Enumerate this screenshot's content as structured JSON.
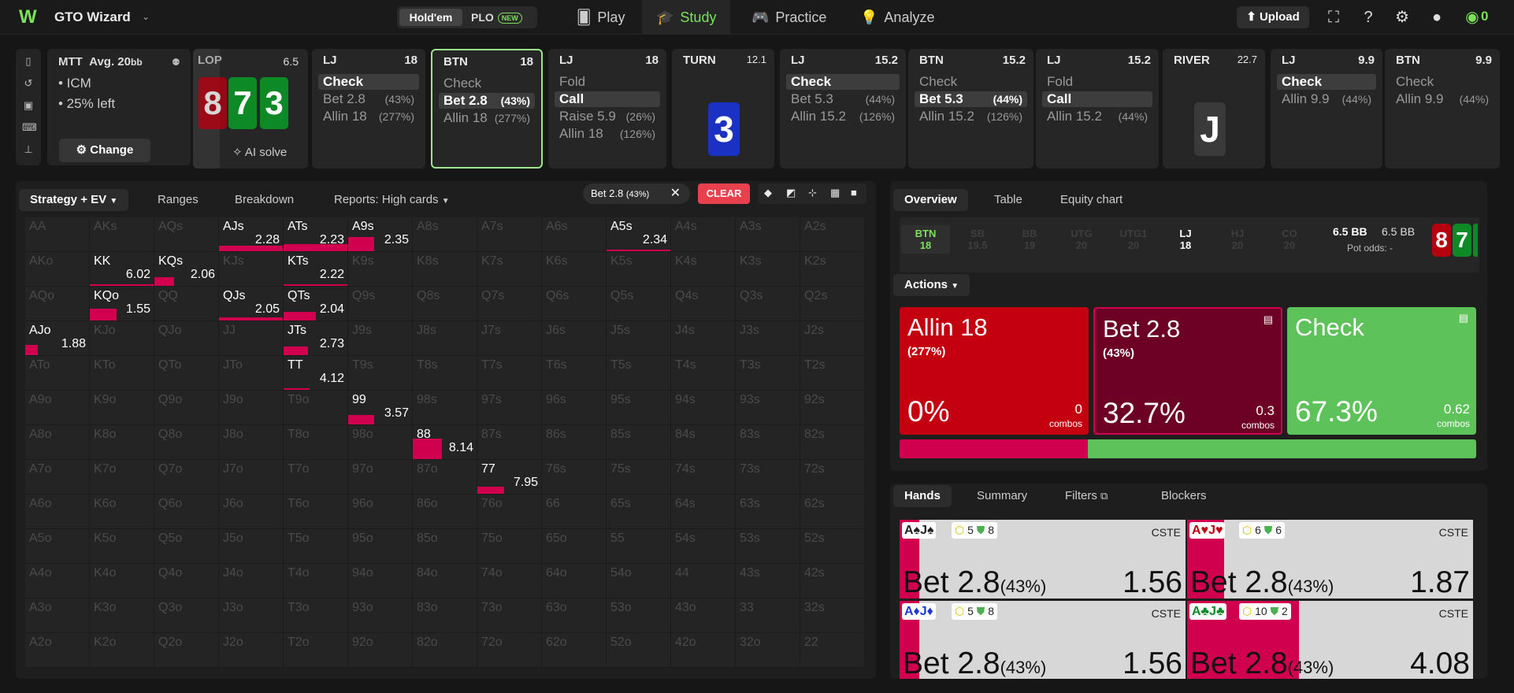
{
  "nav": {
    "app_name": "GTO Wizard",
    "holdem": "Hold'em",
    "plo": "PLO",
    "new_badge": "NEW",
    "play": "Play",
    "study": "Study",
    "practice": "Practice",
    "analyze": "Analyze",
    "upload": "Upload",
    "coins": "0"
  },
  "mtt": {
    "title": "MTT",
    "avg_label": "Avg. 20",
    "avg_unit": "bb",
    "bullet1": "• ICM",
    "bullet2": "• 25% left",
    "change_label": "Change"
  },
  "flop": {
    "label": "LOP",
    "pot": "6.5",
    "cards": [
      "8",
      "7",
      "3"
    ],
    "ai_solve": "AI solve"
  },
  "strip": [
    {
      "pos": "LJ",
      "stack": "18",
      "actions": [
        {
          "t": "Check",
          "p": ""
        },
        {
          "t": "Bet 2.8",
          "p": "(43%)"
        },
        {
          "t": "Allin 18",
          "p": "(277%)"
        }
      ],
      "sel": 0
    },
    {
      "pos": "BTN",
      "stack": "18",
      "actions": [
        {
          "t": "Check",
          "p": ""
        },
        {
          "t": "Bet 2.8",
          "p": "(43%)"
        },
        {
          "t": "Allin 18",
          "p": "(277%)"
        }
      ],
      "sel": 1
    },
    {
      "pos": "LJ",
      "stack": "18",
      "actions": [
        {
          "t": "Fold",
          "p": ""
        },
        {
          "t": "Call",
          "p": ""
        },
        {
          "t": "Raise 5.9",
          "p": "(26%)"
        },
        {
          "t": "Allin 18",
          "p": "(126%)"
        }
      ],
      "sel": 1
    },
    {
      "pos": "LJ",
      "stack": "15.2",
      "actions": [
        {
          "t": "Check",
          "p": ""
        },
        {
          "t": "Bet 5.3",
          "p": "(44%)"
        },
        {
          "t": "Allin 15.2",
          "p": "(126%)"
        }
      ],
      "sel": 0
    },
    {
      "pos": "BTN",
      "stack": "15.2",
      "actions": [
        {
          "t": "Check",
          "p": ""
        },
        {
          "t": "Bet 5.3",
          "p": "(44%)"
        },
        {
          "t": "Allin 15.2",
          "p": "(126%)"
        }
      ],
      "sel": 1
    },
    {
      "pos": "LJ",
      "stack": "15.2",
      "actions": [
        {
          "t": "Fold",
          "p": ""
        },
        {
          "t": "Call",
          "p": ""
        },
        {
          "t": "Allin 15.2",
          "p": "(44%)"
        }
      ],
      "sel": 1
    },
    {
      "pos": "LJ",
      "stack": "9.9",
      "actions": [
        {
          "t": "Check",
          "p": ""
        },
        {
          "t": "Allin 9.9",
          "p": "(44%)"
        }
      ],
      "sel": 0
    },
    {
      "pos": "BTN",
      "stack": "9.9",
      "actions": [
        {
          "t": "Check",
          "p": ""
        },
        {
          "t": "Allin 9.9",
          "p": "(44%)"
        }
      ],
      "sel": -1
    }
  ],
  "turn": {
    "label": "TURN",
    "pot": "12.1",
    "card": "3"
  },
  "river": {
    "label": "RIVER",
    "pot": "22.7",
    "card": "J"
  },
  "left_tabs": {
    "strategy": "Strategy + EV",
    "ranges": "Ranges",
    "breakdown": "Breakdown",
    "reports": "Reports: High cards",
    "filter_chip": "Bet 2.8",
    "filter_pct": "(43%)",
    "clear": "CLEAR"
  },
  "grid": [
    [
      "AA",
      "AKs",
      "AQs",
      "AJs",
      "ATs",
      "A9s",
      "A8s",
      "A7s",
      "A6s",
      "A5s",
      "A4s",
      "A3s",
      "A2s"
    ],
    [
      "AKo",
      "KK",
      "KQs",
      "KJs",
      "KTs",
      "K9s",
      "K8s",
      "K7s",
      "K6s",
      "K5s",
      "K4s",
      "K3s",
      "K2s"
    ],
    [
      "AQo",
      "KQo",
      "QQ",
      "QJs",
      "QTs",
      "Q9s",
      "Q8s",
      "Q7s",
      "Q6s",
      "Q5s",
      "Q4s",
      "Q3s",
      "Q2s"
    ],
    [
      "AJo",
      "KJo",
      "QJo",
      "JJ",
      "JTs",
      "J9s",
      "J8s",
      "J7s",
      "J6s",
      "J5s",
      "J4s",
      "J3s",
      "J2s"
    ],
    [
      "ATo",
      "KTo",
      "QTo",
      "JTo",
      "TT",
      "T9s",
      "T8s",
      "T7s",
      "T6s",
      "T5s",
      "T4s",
      "T3s",
      "T2s"
    ],
    [
      "A9o",
      "K9o",
      "Q9o",
      "J9o",
      "T9o",
      "99",
      "98s",
      "97s",
      "96s",
      "95s",
      "94s",
      "93s",
      "92s"
    ],
    [
      "A8o",
      "K8o",
      "Q8o",
      "J8o",
      "T8o",
      "98o",
      "88",
      "87s",
      "86s",
      "85s",
      "84s",
      "83s",
      "82s"
    ],
    [
      "A7o",
      "K7o",
      "Q7o",
      "J7o",
      "T7o",
      "97o",
      "87o",
      "77",
      "76s",
      "75s",
      "74s",
      "73s",
      "72s"
    ],
    [
      "A6o",
      "K6o",
      "Q6o",
      "J6o",
      "T6o",
      "96o",
      "86o",
      "76o",
      "66",
      "65s",
      "64s",
      "63s",
      "62s"
    ],
    [
      "A5o",
      "K5o",
      "Q5o",
      "J5o",
      "T5o",
      "95o",
      "85o",
      "75o",
      "65o",
      "55",
      "54s",
      "53s",
      "52s"
    ],
    [
      "A4o",
      "K4o",
      "Q4o",
      "J4o",
      "T4o",
      "94o",
      "84o",
      "74o",
      "64o",
      "54o",
      "44",
      "43s",
      "42s"
    ],
    [
      "A3o",
      "K3o",
      "Q3o",
      "J3o",
      "T3o",
      "93o",
      "83o",
      "73o",
      "63o",
      "53o",
      "43o",
      "33",
      "32s"
    ],
    [
      "A2o",
      "K2o",
      "Q2o",
      "J2o",
      "T2o",
      "92o",
      "82o",
      "72o",
      "62o",
      "52o",
      "42o",
      "32o",
      "22"
    ]
  ],
  "grid_values": [
    {
      "r": 0,
      "c": 3,
      "ev": "2.28",
      "freq": 0.15,
      "w": 1
    },
    {
      "r": 0,
      "c": 4,
      "ev": "2.23",
      "freq": 0.2,
      "w": 1
    },
    {
      "r": 0,
      "c": 5,
      "ev": "2.35",
      "freq": 0.4,
      "w": 0.4
    },
    {
      "r": 0,
      "c": 9,
      "ev": "2.34",
      "freq": 0.03,
      "w": 1
    },
    {
      "r": 1,
      "c": 1,
      "ev": "6.02",
      "freq": 0.05,
      "w": 1
    },
    {
      "r": 1,
      "c": 2,
      "ev": "2.06",
      "freq": 0.25,
      "w": 0.3
    },
    {
      "r": 1,
      "c": 4,
      "ev": "2.22",
      "freq": 0.03,
      "w": 1
    },
    {
      "r": 2,
      "c": 1,
      "ev": "1.55",
      "freq": 0.35,
      "w": 0.42
    },
    {
      "r": 2,
      "c": 3,
      "ev": "2.05",
      "freq": 0.08,
      "w": 1
    },
    {
      "r": 2,
      "c": 4,
      "ev": "2.04",
      "freq": 0.25,
      "w": 0.5
    },
    {
      "r": 3,
      "c": 0,
      "ev": "1.88",
      "freq": 0.3,
      "w": 0.2
    },
    {
      "r": 3,
      "c": 4,
      "ev": "2.73",
      "freq": 0.25,
      "w": 0.38
    },
    {
      "r": 4,
      "c": 4,
      "ev": "4.12",
      "freq": 0.03,
      "w": 0.4
    },
    {
      "r": 5,
      "c": 5,
      "ev": "3.57",
      "freq": 0.28,
      "w": 0.4
    },
    {
      "r": 6,
      "c": 6,
      "ev": "8.14",
      "freq": 0.6,
      "w": 0.45
    },
    {
      "r": 7,
      "c": 7,
      "ev": "7.95",
      "freq": 0.2,
      "w": 0.42
    }
  ],
  "right_tabs": {
    "overview": "Overview",
    "table": "Table",
    "equity": "Equity chart"
  },
  "positions": [
    {
      "n": "BTN",
      "s": "18",
      "state": "active"
    },
    {
      "n": "SB",
      "s": "19.5",
      "state": "dim"
    },
    {
      "n": "BB",
      "s": "19",
      "state": "dim"
    },
    {
      "n": "UTG",
      "s": "20",
      "state": "dim"
    },
    {
      "n": "UTG1",
      "s": "20",
      "state": "dim"
    },
    {
      "n": "LJ",
      "s": "18",
      "state": "white"
    },
    {
      "n": "HJ",
      "s": "20",
      "state": "dim"
    },
    {
      "n": "CO",
      "s": "20",
      "state": "dim"
    }
  ],
  "pot": {
    "a": "6.5 BB",
    "b": "6.5 BB",
    "odds_label": "Pot odds:",
    "odds_val": "-"
  },
  "actions_label": "Actions",
  "big_actions": [
    {
      "name": "Allin 18",
      "sub": "(277%)",
      "pct": "0%",
      "combos": "0",
      "combos_lbl": "combos",
      "color": "#c40010"
    },
    {
      "name": "Bet 2.8",
      "sub": "(43%)",
      "pct": "32.7%",
      "combos": "0.3",
      "combos_lbl": "combos",
      "color": "#6d0025"
    },
    {
      "name": "Check",
      "sub": "",
      "pct": "67.3%",
      "combos": "0.62",
      "combos_lbl": "combos",
      "color": "#5ec25a"
    }
  ],
  "freq_bar": {
    "bet": 0.327,
    "check": 0.673
  },
  "hand_tabs": {
    "hands": "Hands",
    "summary": "Summary",
    "filters": "Filters",
    "blockers": "Blockers"
  },
  "hands": [
    {
      "c1": "A♠",
      "c2": "J♠",
      "col1": "#222",
      "col2": "#222",
      "b1": "5",
      "b2": "8",
      "cste": "CSTE",
      "act": "Bet 2.8",
      "pct": "(43%)",
      "val": "1.56",
      "fill": 0.07
    },
    {
      "c1": "A♥",
      "c2": "J♥",
      "col1": "#c00010",
      "col2": "#c00010",
      "b1": "6",
      "b2": "6",
      "cste": "CSTE",
      "act": "Bet 2.8",
      "pct": "(43%)",
      "val": "1.87",
      "fill": 0.13
    },
    {
      "c1": "A♦",
      "c2": "J♦",
      "col1": "#1d37d8",
      "col2": "#1d37d8",
      "b1": "5",
      "b2": "8",
      "cste": "CSTE",
      "act": "Bet 2.8",
      "pct": "(43%)",
      "val": "1.56",
      "fill": 0.07
    },
    {
      "c1": "A♣",
      "c2": "J♣",
      "col1": "#0b8a2a",
      "col2": "#0b8a2a",
      "b1": "10",
      "b2": "2",
      "cste": "CSTE",
      "act": "Bet 2.8",
      "pct": "(43%)",
      "val": "4.08",
      "fill": 0.39
    }
  ],
  "colors": {
    "accent": "#7be05a",
    "bet": "#d0004f",
    "allin": "#c40010",
    "check": "#5ec25a"
  }
}
